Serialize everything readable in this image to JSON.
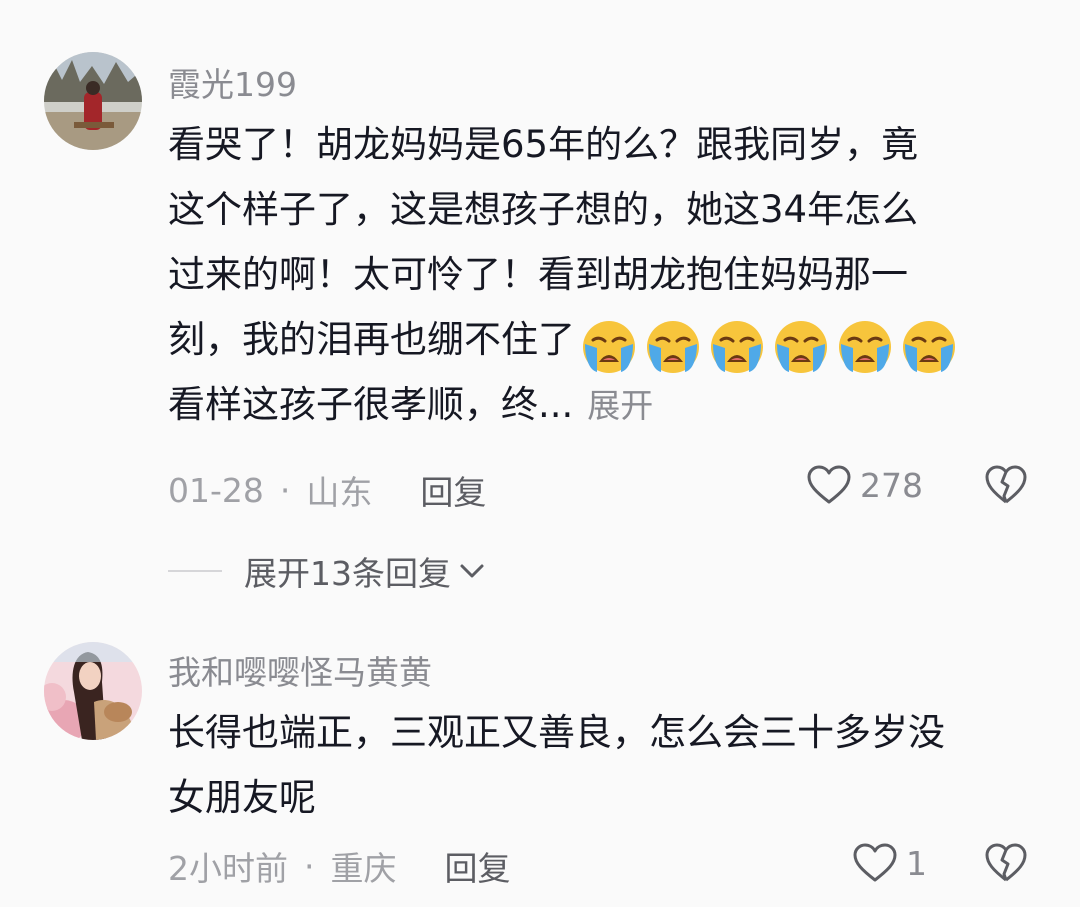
{
  "comments": [
    {
      "username": "霞光199",
      "lines": [
        "看哭了！胡龙妈妈是65年的么？跟我同岁，竟",
        "这个样子了，这是想孩子想的，她这34年怎么",
        "过来的啊！太可怜了！看到胡龙抱住妈妈那一",
        "刻，我的泪再也绷不住了",
        "看样这孩子很孝顺，终..."
      ],
      "expand_label": "展开",
      "emoji_name": "loudly-crying-face-icon",
      "emoji_count": 6,
      "date": "01-28",
      "separator": "·",
      "location": "山东",
      "reply_label": "回复",
      "like_count": "278",
      "replies_label": "展开13条回复"
    },
    {
      "username": "我和嘤嘤怪马黄黄",
      "lines": [
        "长得也端正，三观正又善良，怎么会三十多岁没",
        "女朋友呢"
      ],
      "date": "2小时前",
      "separator": "·",
      "location": "重庆",
      "reply_label": "回复",
      "like_count": "1"
    }
  ],
  "colors": {
    "background": "#fafafa",
    "text_primary": "#161823",
    "text_secondary": "#8a8b91"
  }
}
